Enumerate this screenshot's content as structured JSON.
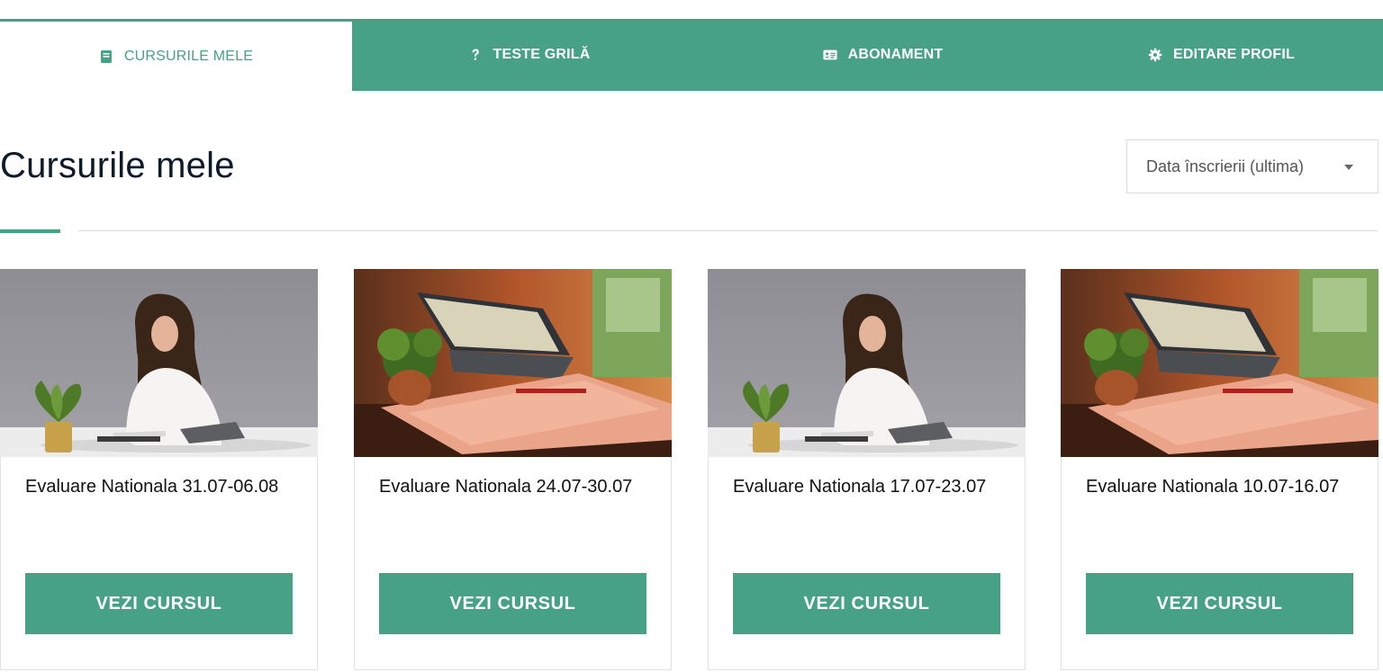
{
  "tabs": [
    {
      "label": "CURSURILE MELE",
      "icon": "book-icon",
      "active": true
    },
    {
      "label": "TESTE GRILĂ",
      "icon": "question-icon",
      "active": false
    },
    {
      "label": "ABONAMENT",
      "icon": "id-card-icon",
      "active": false
    },
    {
      "label": "EDITARE PROFIL",
      "icon": "gear-icon",
      "active": false
    }
  ],
  "page": {
    "title": "Cursurile mele"
  },
  "sort": {
    "selected": "Data înscrierii (ultima)"
  },
  "courses": [
    {
      "title": "Evaluare Nationala 31.07-06.08",
      "button": "VEZI CURSUL",
      "image": "woman-writing-at-desk"
    },
    {
      "title": "Evaluare Nationala 24.07-30.07",
      "button": "VEZI CURSUL",
      "image": "laptop-and-papers-on-desk"
    },
    {
      "title": "Evaluare Nationala 17.07-23.07",
      "button": "VEZI CURSUL",
      "image": "woman-writing-at-desk"
    },
    {
      "title": "Evaluare Nationala 10.07-16.07",
      "button": "VEZI CURSUL",
      "image": "laptop-and-papers-on-desk"
    }
  ],
  "colors": {
    "accent": "#46a185",
    "text": "#0c1b2a",
    "border": "#dcdcdc"
  }
}
